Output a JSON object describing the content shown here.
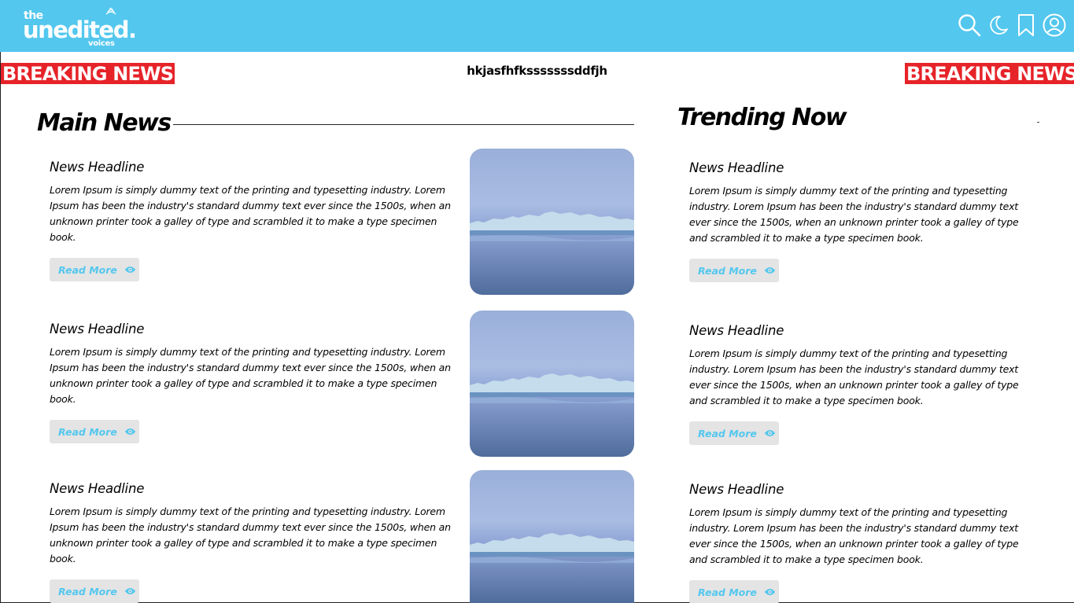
{
  "header": {
    "logo": {
      "line1": "the",
      "line2": "unedited.",
      "line3": "voices"
    },
    "icons": [
      "search-icon",
      "moon-icon",
      "bookmark-icon",
      "user-icon"
    ],
    "accent_color": "#53c7ee"
  },
  "breaking": {
    "left_label": "BREAKING NEWS",
    "right_label": "BREAKING NEWS",
    "ticker": "hkjasfhfksssssssddfjh",
    "color": "#e62329"
  },
  "main": {
    "title": "Main News",
    "articles": [
      {
        "headline": "News Headline",
        "body": "Lorem Ipsum is simply dummy text of the printing and typesetting industry. Lorem Ipsum has been the industry's standard dummy text ever since the 1500s, when an unknown printer took a galley of type and scrambled it to make a type specimen book.",
        "read_more": "Read More"
      },
      {
        "headline": "News Headline",
        "body": "Lorem Ipsum is simply dummy text of the printing and typesetting industry. Lorem Ipsum has been the industry's standard dummy text ever since the 1500s, when an unknown printer took a galley of type and scrambled it to make a type specimen book.",
        "read_more": "Read More"
      },
      {
        "headline": "News Headline",
        "body": "Lorem Ipsum is simply dummy text of the printing and typesetting industry. Lorem Ipsum has been the industry's standard dummy text ever since the 1500s, when an unknown printer took a galley of type and scrambled it to make a type specimen book.",
        "read_more": "Read More"
      }
    ]
  },
  "trending": {
    "title": "Trending Now",
    "articles": [
      {
        "headline": "News Headline",
        "body": "Lorem Ipsum is simply dummy text of the printing and typesetting industry. Lorem Ipsum has been the industry's standard dummy text ever since the 1500s, when an unknown printer took a galley of type and scrambled it to make a type specimen book.",
        "read_more": "Read More"
      },
      {
        "headline": "News Headline",
        "body": "Lorem Ipsum is simply dummy text of the printing and typesetting industry. Lorem Ipsum has been the industry's standard dummy text ever since the 1500s, when an unknown printer took a galley of type and scrambled it to make a type specimen book.",
        "read_more": "Read More"
      },
      {
        "headline": "News Headline",
        "body": "Lorem Ipsum is simply dummy text of the printing and typesetting industry. Lorem Ipsum has been the industry's standard dummy text ever since the 1500s, when an unknown printer took a galley of type and scrambled it to make a type specimen book.",
        "read_more": "Read More"
      }
    ]
  }
}
